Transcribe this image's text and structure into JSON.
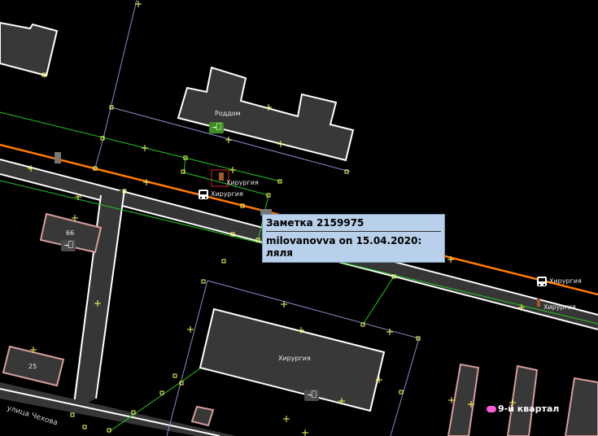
{
  "labels": {
    "roddom": "Роддом",
    "khirurgiya_stop1": "Хирургия",
    "khirurgiya_stop2": "Хирургия",
    "khirurgiya_stop3": "Хирургия",
    "khirurgiya_stop4": "Хирургия",
    "khirurgiya_building": "Хирургия",
    "house_66": "66",
    "house_25": "25",
    "street_chekhova": "улица Чехова",
    "district": "9-й квартал"
  },
  "icons": {
    "entrance": "→⎕",
    "bus_stop": "bus-stop-icon",
    "note": "note-icon",
    "pharmacy": "red-cross"
  },
  "note_popup": {
    "title": "Заметка 2159975",
    "line1": "milovanovva on 15.04.2020:",
    "line2": "ляля"
  },
  "colors": {
    "background": "#000000",
    "building_fill": "#383838",
    "building_outline": "#ffffff",
    "road_fill": "#363636",
    "road_outline": "#ffffff",
    "rail_line": "#ff7a00",
    "footway": "#22c81e",
    "boundary": "#8a8acc",
    "node": "#ffff55",
    "popup_bg": "#b9d0ea"
  }
}
